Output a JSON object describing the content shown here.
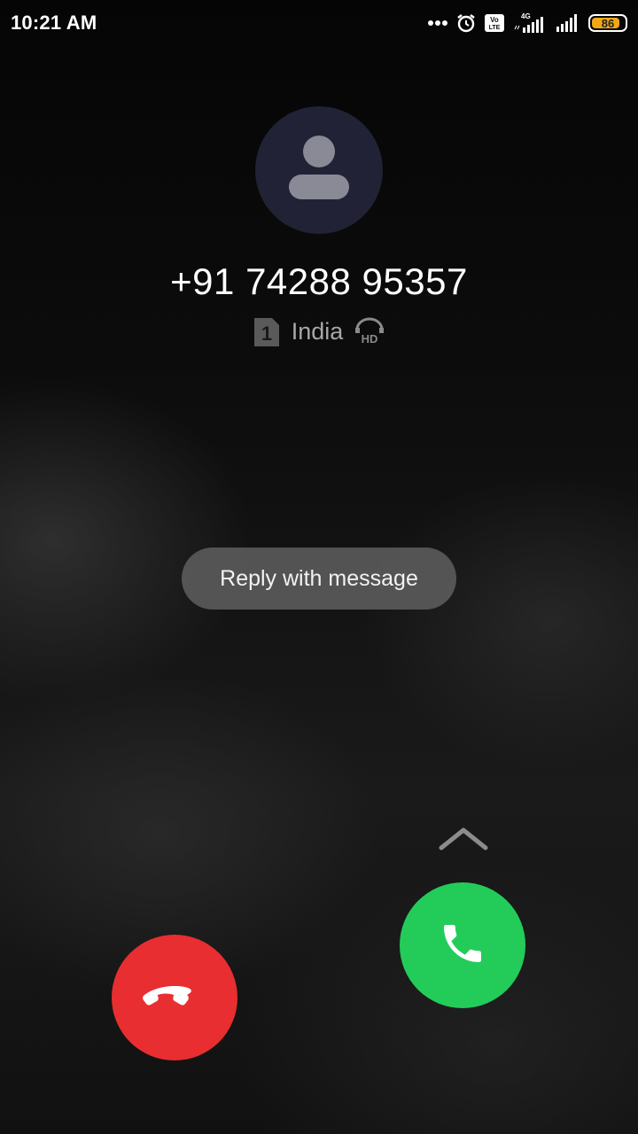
{
  "status_bar": {
    "time": "10:21 AM",
    "network_label": "4G",
    "volte_label": "Vo LTE",
    "battery_level": "86",
    "battery_fraction": 0.86,
    "battery_color": "#f0a818",
    "icons": [
      "more-dots-icon",
      "alarm-icon",
      "volte-icon",
      "signal-4g-icon",
      "signal-icon",
      "battery-icon"
    ]
  },
  "caller": {
    "avatar_icon": "person-icon",
    "number": "+91 74288 95357",
    "sim_slot": "1",
    "location": "India",
    "hd_label": "HD"
  },
  "actions": {
    "reply_label": "Reply with message",
    "swipe_hint_icon": "chevron-up-icon",
    "accept_icon": "phone-icon",
    "decline_icon": "phone-hangup-icon"
  },
  "colors": {
    "accept": "#23cc59",
    "decline": "#e82e30",
    "avatar_bg": "#222236"
  }
}
